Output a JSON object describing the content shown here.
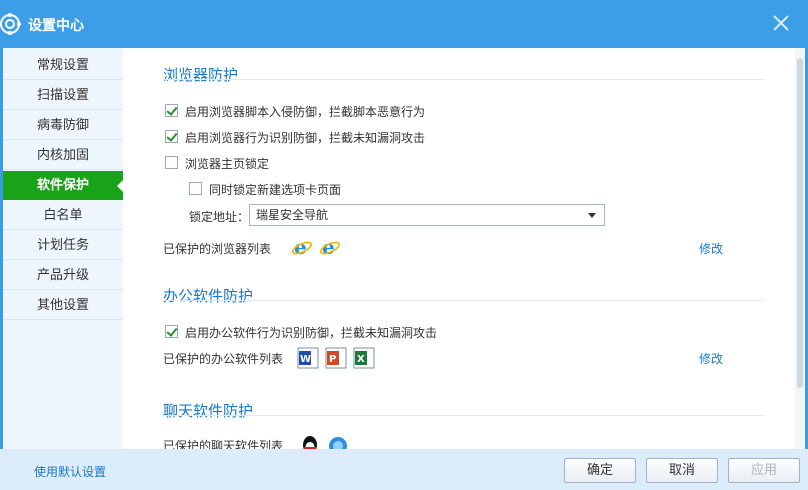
{
  "window": {
    "title": "设置中心"
  },
  "sidebar": {
    "items": [
      {
        "label": "常规设置"
      },
      {
        "label": "扫描设置"
      },
      {
        "label": "病毒防御"
      },
      {
        "label": "内核加固"
      },
      {
        "label": "软件保护",
        "active": true
      },
      {
        "label": "白名单"
      },
      {
        "label": "计划任务"
      },
      {
        "label": "产品升级"
      },
      {
        "label": "其他设置"
      }
    ]
  },
  "browser": {
    "title": "浏览器防护",
    "script_defense": {
      "label": "启用浏览器脚本入侵防御，拦截脚本恶意行为",
      "checked": true
    },
    "behavior_defense": {
      "label": "启用浏览器行为识别防御，拦截未知漏洞攻击",
      "checked": true
    },
    "homepage_lock": {
      "label": "浏览器主页锁定",
      "checked": false
    },
    "newtab_lock": {
      "label": "同时锁定新建选项卡页面",
      "checked": false
    },
    "lock_address_label": "锁定地址：",
    "lock_address_value": "瑞星安全导航",
    "protected_list_label": "已保护的浏览器列表",
    "modify": "修改",
    "icons": [
      "ie-icon",
      "ie-icon"
    ]
  },
  "office": {
    "title": "办公软件防护",
    "behavior_defense": {
      "label": "启用办公软件行为识别防御，拦截未知漏洞攻击",
      "checked": true
    },
    "protected_list_label": "已保护的办公软件列表",
    "modify": "修改",
    "icons": [
      "word-icon",
      "powerpoint-icon",
      "excel-icon"
    ]
  },
  "chat": {
    "title": "聊天软件防护",
    "protected_list_label": "已保护的聊天软件列表",
    "icons": [
      "qq-icon",
      "chat-bubble-icon"
    ]
  },
  "footer": {
    "default_link": "使用默认设置",
    "ok": "确定",
    "cancel": "取消",
    "apply": "应用"
  },
  "colors": {
    "titlebar": "#3d9ee8",
    "active_nav": "#19a319",
    "accent": "#1a78c8"
  }
}
